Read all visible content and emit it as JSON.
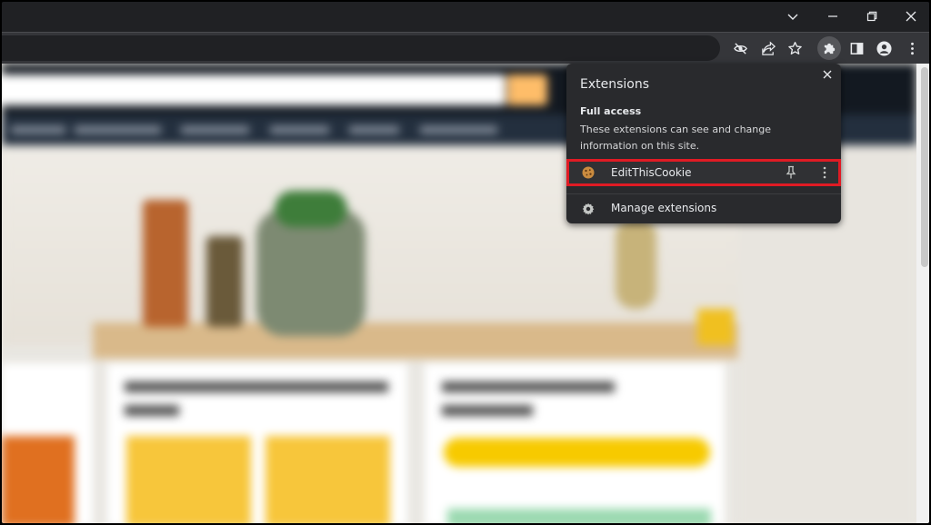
{
  "window": {
    "controls": [
      {
        "name": "tab-search-button",
        "icon": "chevron-down-icon"
      },
      {
        "name": "minimize-button",
        "icon": "minimize-icon"
      },
      {
        "name": "restore-button",
        "icon": "restore-icon"
      },
      {
        "name": "close-window-button",
        "icon": "close-icon"
      }
    ]
  },
  "toolbar": {
    "icons": [
      "eye-off-icon",
      "share-icon",
      "star-icon",
      "puzzle-icon",
      "side-panel-icon",
      "profile-icon",
      "more-vert-icon"
    ],
    "active_icon": "puzzle-icon"
  },
  "extensions_popup": {
    "title": "Extensions",
    "section_title": "Full access",
    "section_desc": "These extensions can see and change information on this site.",
    "items": [
      {
        "name": "EditThisCookie",
        "icon": "cookie-icon"
      }
    ],
    "manage_label": "Manage extensions",
    "highlight_color": "#e01b24"
  },
  "colors": {
    "titlebar": "#202124",
    "toolbar": "#35363a",
    "popup": "#292a2d",
    "text": "#e8eaed",
    "highlight": "#e01b24"
  }
}
